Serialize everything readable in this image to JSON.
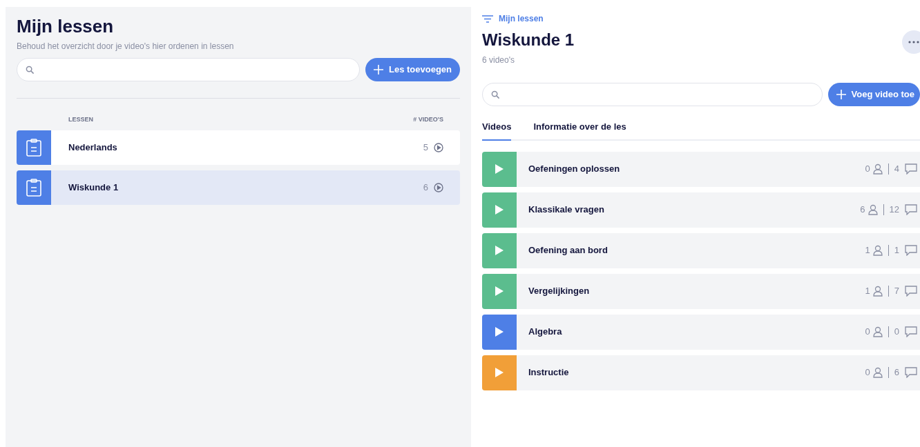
{
  "lessons_panel": {
    "title": "Mijn lessen",
    "subtitle": "Behoud het overzicht door je video's hier ordenen in lessen",
    "add_button": "Les toevoegen",
    "columns": [
      "LESSEN",
      "# VIDEO'S"
    ],
    "rows": [
      {
        "name": "Nederlands",
        "count": "5",
        "selected": false
      },
      {
        "name": "Wiskunde 1",
        "count": "6",
        "selected": true
      }
    ]
  },
  "detail_panel": {
    "breadcrumb": "Mijn lessen",
    "title": "Wiskunde 1",
    "subtitle": "6 video's",
    "add_button": "Voeg video toe",
    "tabs": [
      {
        "label": "Videos",
        "selected": true
      },
      {
        "label": "Informatie over de les",
        "selected": false
      }
    ],
    "videos": [
      {
        "title": "Oefeningen oplossen",
        "viewers": "0",
        "comments": "4",
        "color": "#5bbd8e"
      },
      {
        "title": "Klassikale vragen",
        "viewers": "6",
        "comments": "12",
        "color": "#5bbd8e"
      },
      {
        "title": "Oefening aan bord",
        "viewers": "1",
        "comments": "1",
        "color": "#5bbd8e"
      },
      {
        "title": "Vergelijkingen",
        "viewers": "1",
        "comments": "7",
        "color": "#5bbd8e"
      },
      {
        "title": "Algebra",
        "viewers": "0",
        "comments": "0",
        "color": "#4e7fe6"
      },
      {
        "title": "Instructie",
        "viewers": "0",
        "comments": "6",
        "color": "#f19f38"
      }
    ]
  }
}
